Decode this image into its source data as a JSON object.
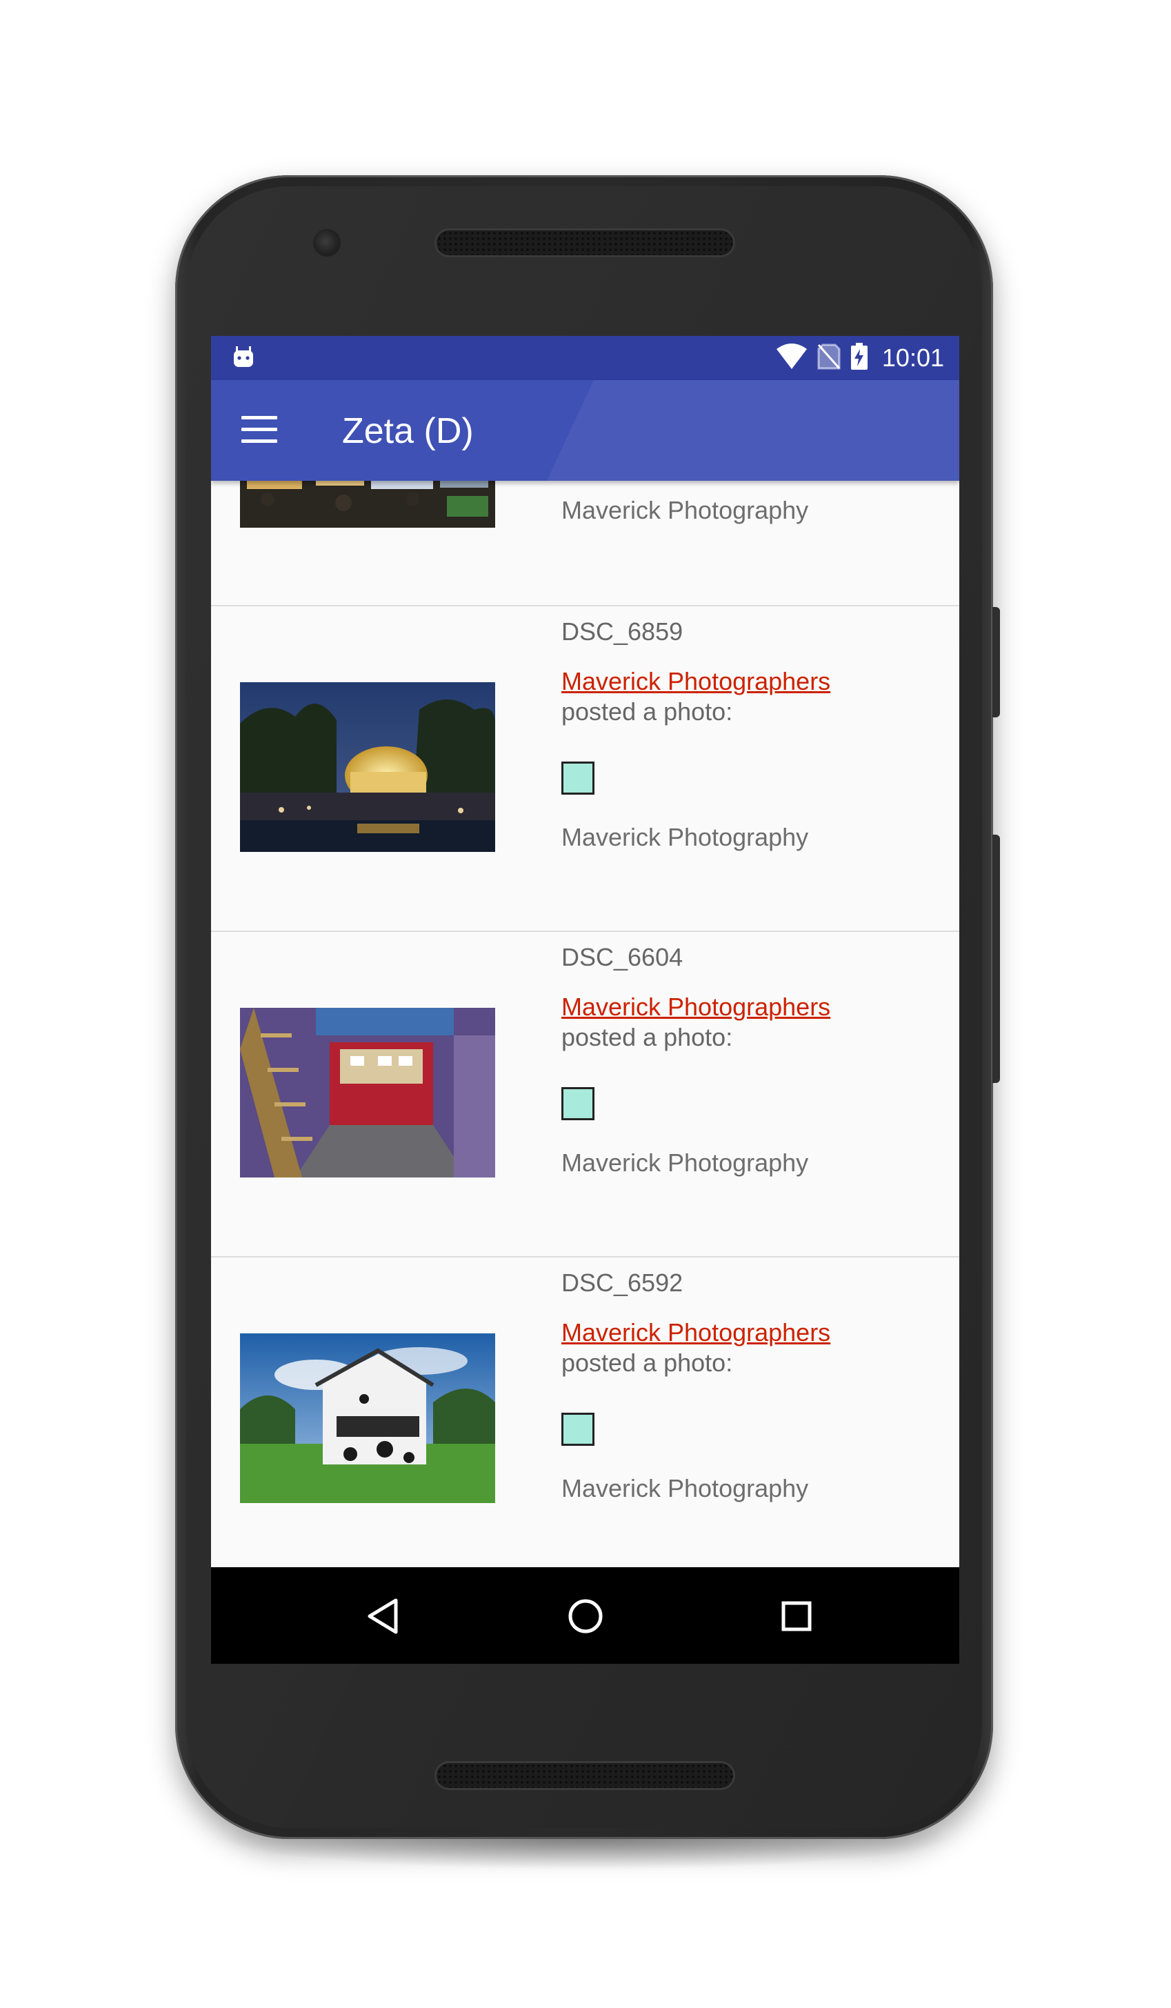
{
  "status_bar": {
    "time": "10:01",
    "icons": [
      "android-debug-icon",
      "wifi-icon",
      "no-sim-icon",
      "battery-charging-icon"
    ]
  },
  "app_bar": {
    "title": "Zeta (D)",
    "menu_icon": "hamburger-menu-icon"
  },
  "feed": {
    "items": [
      {
        "title": "",
        "author": "",
        "action": "",
        "source": "Maverick Photography",
        "image": "night-market-festival-photo"
      },
      {
        "title": "DSC_6859",
        "author": "Maverick Photographers",
        "action": "posted a photo:",
        "source": "Maverick Photography",
        "image": "illuminated-conservatory-night-photo"
      },
      {
        "title": "DSC_6604",
        "author": "Maverick Photographers",
        "action": "posted a photo:",
        "source": "Maverick Photography",
        "image": "red-interior-room-stairs-photo"
      },
      {
        "title": "DSC_6592",
        "author": "Maverick Photographers",
        "action": "posted a photo:",
        "source": "Maverick Photography",
        "image": "cow-pattern-house-field-photo"
      }
    ]
  },
  "colors": {
    "status_bar": "#303f9f",
    "app_bar": "#3f51b5",
    "link": "#cc2200",
    "placeholder_square": "#a8eadb",
    "nav_bar": "#000000"
  },
  "nav_bar": {
    "buttons": [
      "back-icon",
      "home-icon",
      "recents-icon"
    ]
  }
}
